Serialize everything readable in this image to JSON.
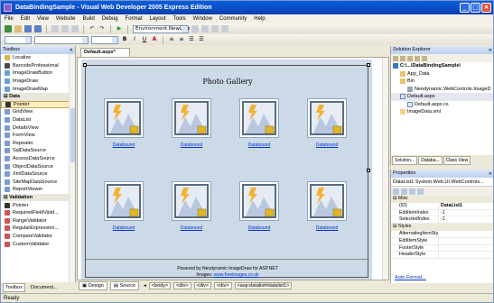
{
  "window": {
    "title": "DataBindingSample - Visual Web Developer 2005 Express Edition"
  },
  "menu": [
    "File",
    "Edit",
    "View",
    "Website",
    "Build",
    "Debug",
    "Format",
    "Layout",
    "Tools",
    "Window",
    "Community",
    "Help"
  ],
  "toolbar": {
    "environment_combo": "Environment.NewLine"
  },
  "toolbox": {
    "title": "Toolbox",
    "items_top": [
      "Localize",
      "BarcodeProfessional",
      "ImageDrawButton",
      "ImageDraw",
      "ImageDrawMap"
    ],
    "groups": [
      {
        "name": "Data",
        "items": [
          "Pointer",
          "GridView",
          "DataList",
          "DetailsView",
          "FormView",
          "Repeater",
          "SqlDataSource",
          "AccessDataSource",
          "ObjectDataSource",
          "XmlDataSource",
          "SiteMapDataSource",
          "ReportViewer"
        ]
      },
      {
        "name": "Validation",
        "items": [
          "Pointer",
          "RequiredFieldValid...",
          "RangeValidator",
          "RegularExpression...",
          "CompareValidator",
          "CustomValidator"
        ]
      }
    ],
    "tabs": [
      "Toolbox",
      "Document..."
    ]
  },
  "document_tab": "Default.aspx*",
  "page": {
    "title": "Photo Gallery",
    "link_label": "Databound",
    "footer_line1": "Powered by Neodynamic ImageDraw for ASP.NET",
    "footer_label": "Images:",
    "footer_link": "www.freeimages.co.uk"
  },
  "editor_bar": {
    "design": "Design",
    "source": "Source",
    "crumbs": [
      "<body>",
      "<div>",
      "<div>",
      "<div>",
      "<asp:datalist#datalist1>"
    ]
  },
  "solution_explorer": {
    "title": "Solution Explorer",
    "nodes": [
      "C:\\...\\DataBindingSample\\",
      "App_Data",
      "Bin",
      "Neodynamic.WebControls.ImageD",
      "Default.aspx",
      "Default.aspx.cs",
      "ImageData.xml"
    ],
    "tabs": [
      "Solution...",
      "Databa...",
      "Class View"
    ]
  },
  "properties": {
    "title": "Properties",
    "selector": "DataList1 System.Web.UI.WebControls...",
    "category": "Misc",
    "rows": [
      {
        "k": "(ID)",
        "v": "DataList1"
      },
      {
        "k": "EditItemIndex",
        "v": "-1"
      },
      {
        "k": "SelectedIndex",
        "v": "-1"
      }
    ],
    "category2": "Styles",
    "rows2": [
      {
        "k": "AlternatingItemStyle",
        "v": ""
      },
      {
        "k": "EditItemStyle",
        "v": ""
      },
      {
        "k": "FooterStyle",
        "v": ""
      },
      {
        "k": "HeaderStyle",
        "v": ""
      }
    ],
    "auto_format": "Auto Format..."
  },
  "status": "Ready",
  "colors": {
    "titlebar": "#0a5fdc",
    "link": "#0033cc",
    "canvas": "#ccd9e7"
  }
}
